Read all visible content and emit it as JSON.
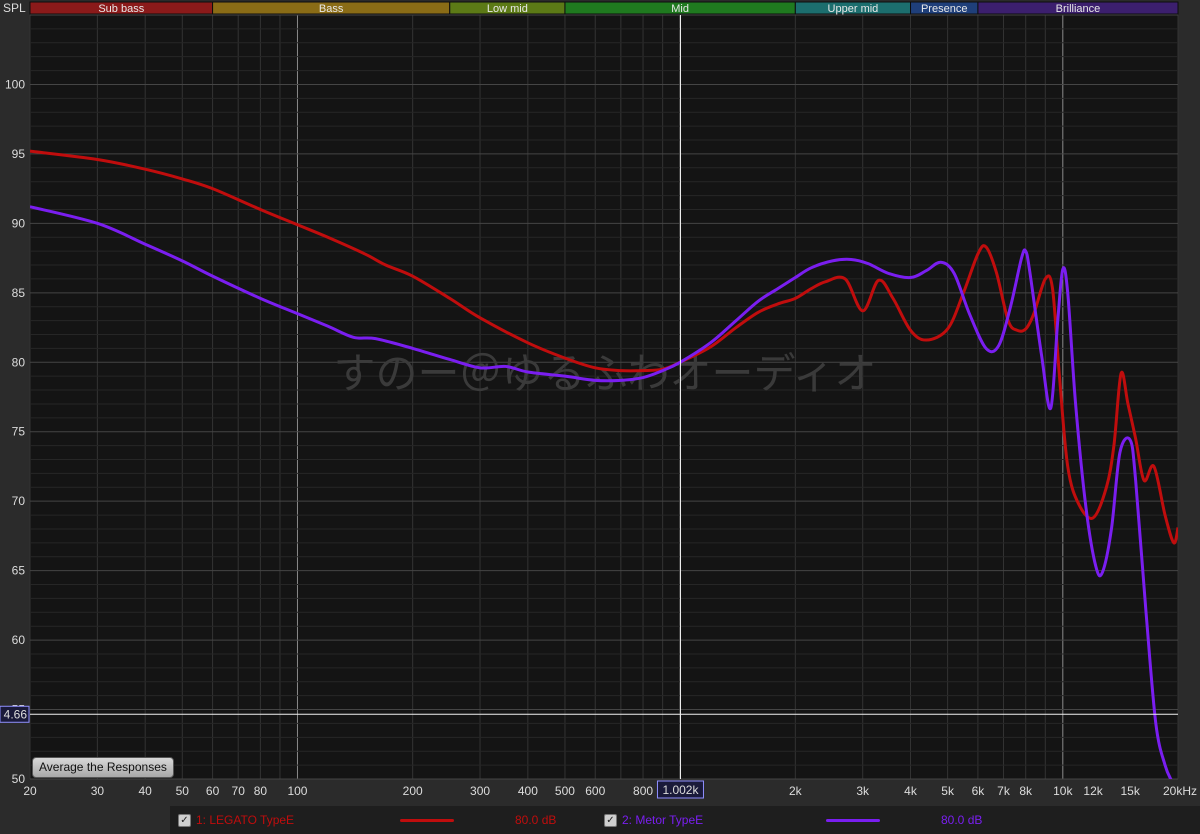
{
  "chart_data": {
    "type": "line",
    "title": "",
    "xlabel": "",
    "ylabel": "SPL",
    "x_scale": "log",
    "xlim": [
      20,
      20000
    ],
    "ylim": [
      50,
      105
    ],
    "y_ticks": [
      "50",
      "55",
      "60",
      "65",
      "70",
      "75",
      "80",
      "85",
      "90",
      "95",
      "100"
    ],
    "x_ticks": [
      {
        "value": 20,
        "label": "20"
      },
      {
        "value": 30,
        "label": "30"
      },
      {
        "value": 40,
        "label": "40"
      },
      {
        "value": 50,
        "label": "50"
      },
      {
        "value": 60,
        "label": "60"
      },
      {
        "value": 70,
        "label": "70"
      },
      {
        "value": 80,
        "label": "80"
      },
      {
        "value": 100,
        "label": "100"
      },
      {
        "value": 200,
        "label": "200"
      },
      {
        "value": 300,
        "label": "300"
      },
      {
        "value": 400,
        "label": "400"
      },
      {
        "value": 500,
        "label": "500"
      },
      {
        "value": 600,
        "label": "600"
      },
      {
        "value": 800,
        "label": "800"
      },
      {
        "value": 2000,
        "label": "2k"
      },
      {
        "value": 3000,
        "label": "3k"
      },
      {
        "value": 4000,
        "label": "4k"
      },
      {
        "value": 5000,
        "label": "5k"
      },
      {
        "value": 6000,
        "label": "6k"
      },
      {
        "value": 7000,
        "label": "7k"
      },
      {
        "value": 8000,
        "label": "8k"
      },
      {
        "value": 10000,
        "label": "10k"
      },
      {
        "value": 12000,
        "label": "12k"
      },
      {
        "value": 15000,
        "label": "15k"
      },
      {
        "value": 20000,
        "label": "20kHz"
      }
    ],
    "cursor": {
      "x_value": 1002,
      "x_label": "1.002k",
      "y_value": 54.66,
      "y_label": "4.66"
    },
    "bands": [
      {
        "name": "Sub bass",
        "from": 20,
        "to": 60,
        "color": "#8b1a1a"
      },
      {
        "name": "Bass",
        "from": 60,
        "to": 250,
        "color": "#8a6c16"
      },
      {
        "name": "Low mid",
        "from": 250,
        "to": 500,
        "color": "#5c7a16"
      },
      {
        "name": "Mid",
        "from": 500,
        "to": 2000,
        "color": "#1f7a1f"
      },
      {
        "name": "Upper mid",
        "from": 2000,
        "to": 4000,
        "color": "#1c6e6e"
      },
      {
        "name": "Presence",
        "from": 4000,
        "to": 6000,
        "color": "#1f3f7a"
      },
      {
        "name": "Brilliance",
        "from": 6000,
        "to": 20000,
        "color": "#3c1f6e"
      }
    ],
    "watermark": "すのー＠ゆるふわオーディオ",
    "grid": true,
    "series": [
      {
        "name": "1: LEGATO TypeE",
        "level": "80.0 dB",
        "color": "#c00d0d",
        "points": [
          [
            20,
            95.2
          ],
          [
            30,
            94.6
          ],
          [
            40,
            93.9
          ],
          [
            50,
            93.2
          ],
          [
            60,
            92.5
          ],
          [
            80,
            91.0
          ],
          [
            100,
            89.9
          ],
          [
            120,
            89.0
          ],
          [
            150,
            87.8
          ],
          [
            170,
            87.0
          ],
          [
            200,
            86.2
          ],
          [
            250,
            84.6
          ],
          [
            300,
            83.2
          ],
          [
            400,
            81.4
          ],
          [
            500,
            80.3
          ],
          [
            600,
            79.6
          ],
          [
            700,
            79.4
          ],
          [
            800,
            79.4
          ],
          [
            900,
            79.5
          ],
          [
            1000,
            80.0
          ],
          [
            1200,
            81.1
          ],
          [
            1400,
            82.5
          ],
          [
            1600,
            83.6
          ],
          [
            1800,
            84.2
          ],
          [
            2000,
            84.6
          ],
          [
            2200,
            85.3
          ],
          [
            2400,
            85.8
          ],
          [
            2700,
            86.0
          ],
          [
            3000,
            83.7
          ],
          [
            3300,
            85.9
          ],
          [
            3600,
            84.6
          ],
          [
            4000,
            82.3
          ],
          [
            4400,
            81.6
          ],
          [
            5000,
            82.4
          ],
          [
            5500,
            85.0
          ],
          [
            6000,
            87.8
          ],
          [
            6300,
            88.3
          ],
          [
            6700,
            86.5
          ],
          [
            7200,
            83.0
          ],
          [
            7600,
            82.3
          ],
          [
            8000,
            82.4
          ],
          [
            8400,
            83.5
          ],
          [
            9000,
            86.0
          ],
          [
            9400,
            85.3
          ],
          [
            9800,
            79.0
          ],
          [
            10300,
            72.5
          ],
          [
            11000,
            69.8
          ],
          [
            12000,
            68.8
          ],
          [
            13000,
            71.0
          ],
          [
            13600,
            74.0
          ],
          [
            14200,
            79.2
          ],
          [
            14800,
            77.0
          ],
          [
            15500,
            74.5
          ],
          [
            16300,
            71.5
          ],
          [
            17300,
            72.5
          ],
          [
            18500,
            69.0
          ],
          [
            19500,
            67.0
          ],
          [
            20000,
            68.1
          ]
        ]
      },
      {
        "name": "2: Metor TypeE",
        "level": "80.0 dB",
        "color": "#7a1ef0",
        "points": [
          [
            20,
            91.2
          ],
          [
            30,
            90.0
          ],
          [
            40,
            88.5
          ],
          [
            50,
            87.3
          ],
          [
            60,
            86.2
          ],
          [
            80,
            84.6
          ],
          [
            100,
            83.5
          ],
          [
            120,
            82.6
          ],
          [
            140,
            81.8
          ],
          [
            160,
            81.7
          ],
          [
            200,
            81.0
          ],
          [
            250,
            80.2
          ],
          [
            300,
            79.6
          ],
          [
            350,
            79.7
          ],
          [
            400,
            79.3
          ],
          [
            500,
            79.0
          ],
          [
            600,
            78.7
          ],
          [
            700,
            78.7
          ],
          [
            800,
            78.9
          ],
          [
            900,
            79.4
          ],
          [
            1000,
            80.0
          ],
          [
            1200,
            81.4
          ],
          [
            1400,
            83.0
          ],
          [
            1600,
            84.4
          ],
          [
            1800,
            85.3
          ],
          [
            2000,
            86.1
          ],
          [
            2200,
            86.8
          ],
          [
            2500,
            87.3
          ],
          [
            2800,
            87.4
          ],
          [
            3100,
            87.1
          ],
          [
            3500,
            86.4
          ],
          [
            4000,
            86.1
          ],
          [
            4400,
            86.6
          ],
          [
            4800,
            87.2
          ],
          [
            5200,
            86.4
          ],
          [
            5700,
            83.5
          ],
          [
            6300,
            81.0
          ],
          [
            6800,
            81.2
          ],
          [
            7300,
            84.0
          ],
          [
            7800,
            87.5
          ],
          [
            8000,
            88.0
          ],
          [
            8200,
            86.5
          ],
          [
            8800,
            80.5
          ],
          [
            9300,
            76.7
          ],
          [
            9700,
            83.0
          ],
          [
            10000,
            86.7
          ],
          [
            10300,
            85.0
          ],
          [
            10800,
            77.0
          ],
          [
            11500,
            69.5
          ],
          [
            12200,
            65.3
          ],
          [
            12700,
            64.9
          ],
          [
            13400,
            68.0
          ],
          [
            14100,
            73.5
          ],
          [
            15000,
            74.4
          ],
          [
            15500,
            71.5
          ],
          [
            16500,
            62.0
          ],
          [
            17500,
            54.0
          ],
          [
            18500,
            51.0
          ],
          [
            19300,
            49.8
          ]
        ]
      }
    ]
  },
  "controls": {
    "average_button": "Average the Responses"
  }
}
